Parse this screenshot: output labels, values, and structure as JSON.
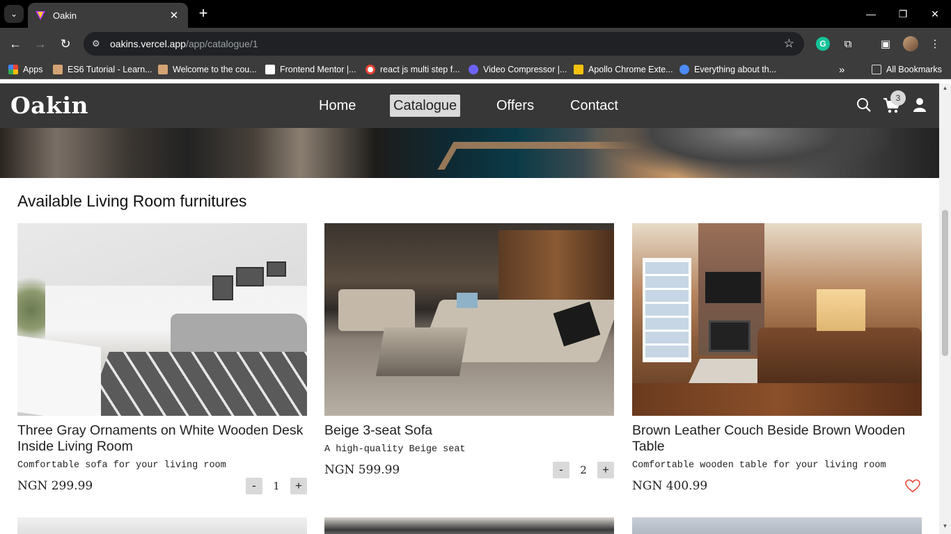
{
  "browser": {
    "tab_title": "Oakin",
    "url_host": "oakins.vercel.app",
    "url_path": "/app/catalogue/1",
    "bookmarks": [
      {
        "label": "Apps",
        "color": "#4285f4"
      },
      {
        "label": "ES6 Tutorial - Learn...",
        "color": "#d4a373"
      },
      {
        "label": "Welcome to the cou...",
        "color": "#d4a373"
      },
      {
        "label": "Frontend Mentor |...",
        "color": "#ffffff"
      },
      {
        "label": "react js multi step f...",
        "color": "#ea4335"
      },
      {
        "label": "Video Compressor |...",
        "color": "#6c63ff"
      },
      {
        "label": "Apollo Chrome Exte...",
        "color": "#f4c20d"
      },
      {
        "label": "Everything about th...",
        "color": "#4c8bf5"
      }
    ],
    "all_bookmarks": "All Bookmarks"
  },
  "site": {
    "logo": "Oakin",
    "nav": [
      "Home",
      "Catalogue",
      "Offers",
      "Contact"
    ],
    "active_nav": "Catalogue",
    "cart_count": "3"
  },
  "section_title": "Available Living Room furnitures",
  "products": [
    {
      "name": "Three Gray Ornaments on White Wooden Desk Inside Living Room",
      "description": "Comfortable sofa for your living room",
      "price": "NGN 299.99",
      "quantity": "1",
      "decrement": "-",
      "increment": "+"
    },
    {
      "name": "Beige 3-seat Sofa",
      "description": "A high-quality Beige seat",
      "price": "NGN 599.99",
      "quantity": "2",
      "decrement": "-",
      "increment": "+"
    },
    {
      "name": "Brown Leather Couch Beside Brown Wooden Table",
      "description": "Comfortable wooden table for your living room",
      "price": "NGN 400.99"
    }
  ],
  "colors": {
    "nav_bg": "#373737",
    "active_nav_bg": "#d9d9d9",
    "heart": "#e74c3c"
  }
}
